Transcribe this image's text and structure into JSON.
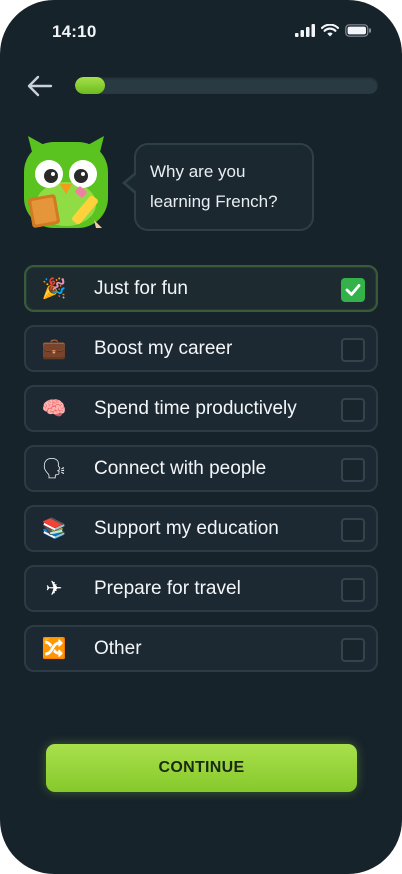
{
  "status_bar": {
    "time": "14:10"
  },
  "progress": {
    "value": 0.1
  },
  "prompt": {
    "line1": "Why are you",
    "line2": "learning French?"
  },
  "options": [
    {
      "label": "Just for fun",
      "icon": "party-popper-icon",
      "glyph": "🎉",
      "checked": true
    },
    {
      "label": "Boost my career",
      "icon": "briefcase-icon",
      "glyph": "💼",
      "checked": false
    },
    {
      "label": "Spend time productively",
      "icon": "brain-icon",
      "glyph": "🧠",
      "checked": false
    },
    {
      "label": "Connect with people",
      "icon": "speaking-head-icon",
      "glyph": "🗣",
      "checked": false
    },
    {
      "label": "Support my education",
      "icon": "books-icon",
      "glyph": "📚",
      "checked": false
    },
    {
      "label": "Prepare for travel",
      "icon": "airplane-icon",
      "glyph": "✈",
      "checked": false
    },
    {
      "label": "Other",
      "icon": "shuffle-icon",
      "glyph": "🔀",
      "checked": false
    }
  ],
  "continue_label": "CONTINUE",
  "colors": {
    "background": "#17232b",
    "accent_green": "#8ccd30",
    "check_green": "#33b24a"
  }
}
